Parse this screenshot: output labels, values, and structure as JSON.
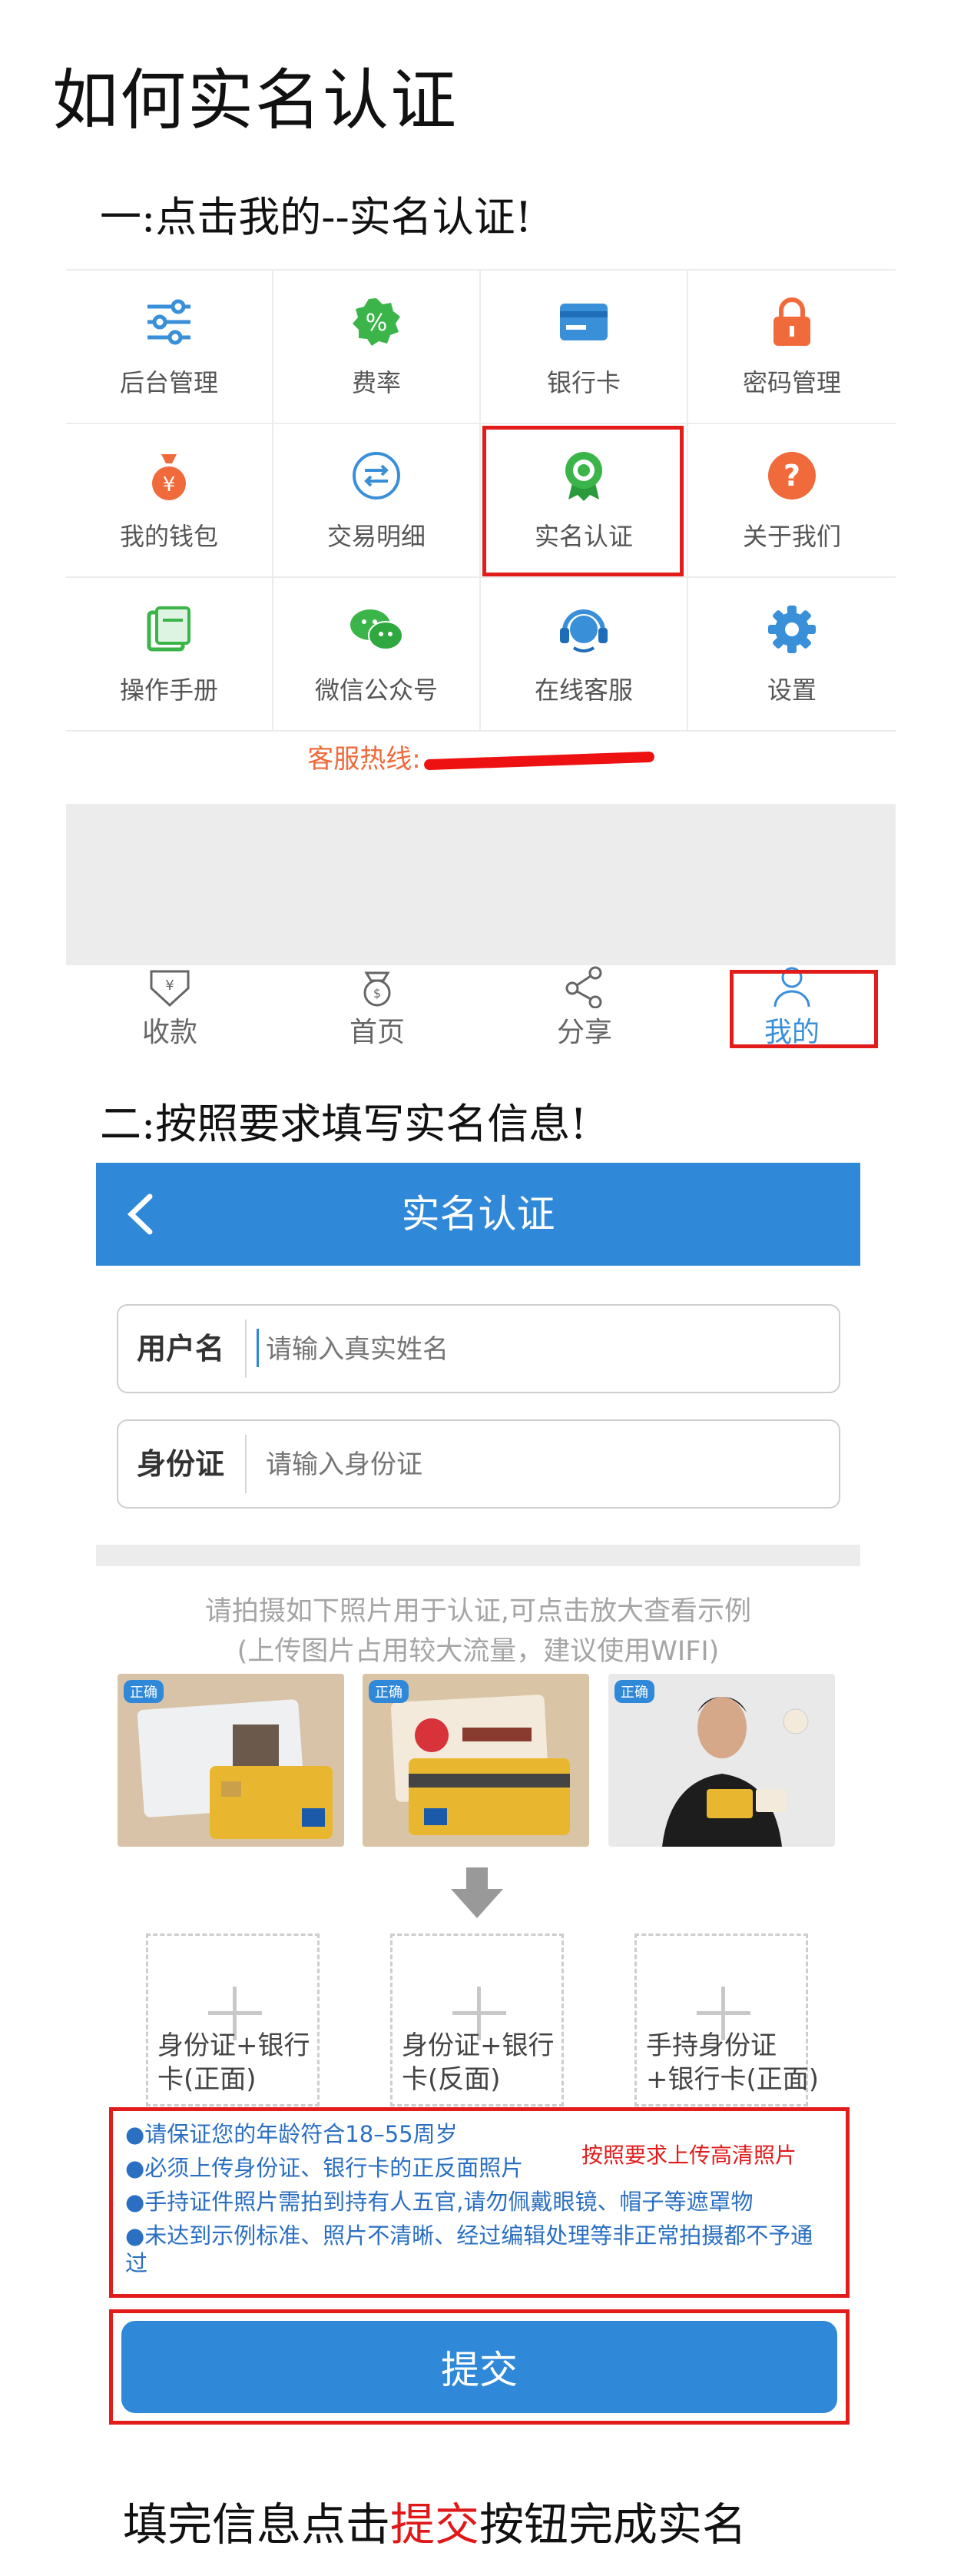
{
  "title": "如何实名认证",
  "step1": "一:点击我的--实名认证!",
  "step2": "二:按照要求填写实名信息!",
  "my_grid": {
    "items": [
      {
        "label": "后台管理",
        "icon": "sliders-icon",
        "color": "#3a8fd9"
      },
      {
        "label": "费率",
        "icon": "percent-badge-icon",
        "color": "#3bb54a"
      },
      {
        "label": "银行卡",
        "icon": "bank-card-icon",
        "color": "#3a8fd9"
      },
      {
        "label": "密码管理",
        "icon": "lock-icon",
        "color": "#f06a3b"
      },
      {
        "label": "我的钱包",
        "icon": "money-bag-icon",
        "color": "#f06a3b"
      },
      {
        "label": "交易明细",
        "icon": "exchange-icon",
        "color": "#3a8fd9"
      },
      {
        "label": "实名认证",
        "icon": "certificate-icon",
        "color": "#3bb54a"
      },
      {
        "label": "关于我们",
        "icon": "question-icon",
        "color": "#f06a3b"
      },
      {
        "label": "操作手册",
        "icon": "manual-icon",
        "color": "#3bb54a"
      },
      {
        "label": "微信公众号",
        "icon": "wechat-icon",
        "color": "#3bb54a"
      },
      {
        "label": "在线客服",
        "icon": "headset-icon",
        "color": "#3a8fd9"
      },
      {
        "label": "设置",
        "icon": "gear-icon",
        "color": "#3a8fd9"
      }
    ],
    "hotline": "客服热线:"
  },
  "tabbar": {
    "items": [
      {
        "label": "收款",
        "icon": "receive-money-icon"
      },
      {
        "label": "首页",
        "icon": "home-money-icon"
      },
      {
        "label": "分享",
        "icon": "share-icon"
      },
      {
        "label": "我的",
        "icon": "user-icon"
      }
    ]
  },
  "verify_page": {
    "header_title": "实名认证",
    "username_label": "用户名",
    "username_placeholder": "请输入真实姓名",
    "id_label": "身份证",
    "id_placeholder": "请输入身份证",
    "hint_line1": "请拍摄如下照片用于认证,可点击放大查看示例",
    "hint_line2": "(上传图片占用较大流量，建议使用WIFI)",
    "sample_badge": "正确",
    "uploads": [
      {
        "line1": "身份证+银行",
        "line2": "卡(正面)"
      },
      {
        "line1": "身份证+银行",
        "line2": "卡(反面)"
      },
      {
        "line1": "手持身份证",
        "line2": "+银行卡(正面)"
      }
    ],
    "notes": [
      "●请保证您的年龄符合18–55周岁",
      "●必须上传身份证、银行卡的正反面照片",
      "●手持证件照片需拍到持有人五官,请勿佩戴眼镜、帽子等遮罩物",
      "●未达到示例标准、照片不清晰、经过编辑处理等非正常拍摄都不予通过"
    ],
    "notes_red": "按照要求上传高清照片",
    "submit_label": "提交"
  },
  "bottom_note": {
    "before": "填完信息点击",
    "highlight": "提交",
    "after": "按钮完成实名"
  },
  "colors": {
    "accent_blue": "#2f88d8",
    "highlight_red": "#e21b1b",
    "orange": "#f06a3b",
    "green": "#3bb54a"
  }
}
